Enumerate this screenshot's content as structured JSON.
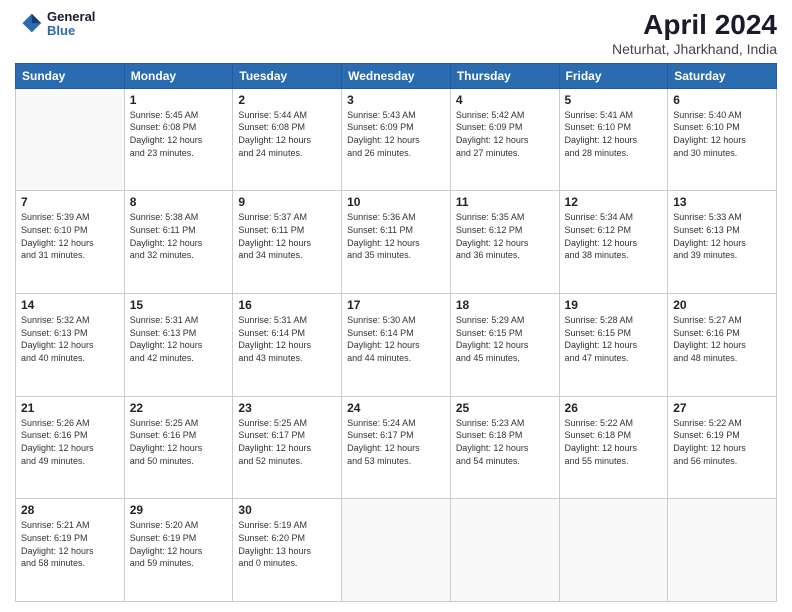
{
  "header": {
    "logo_line1": "General",
    "logo_line2": "Blue",
    "title": "April 2024",
    "subtitle": "Neturhat, Jharkhand, India"
  },
  "calendar": {
    "days_of_week": [
      "Sunday",
      "Monday",
      "Tuesday",
      "Wednesday",
      "Thursday",
      "Friday",
      "Saturday"
    ],
    "weeks": [
      [
        {
          "day": "",
          "info": ""
        },
        {
          "day": "1",
          "info": "Sunrise: 5:45 AM\nSunset: 6:08 PM\nDaylight: 12 hours\nand 23 minutes."
        },
        {
          "day": "2",
          "info": "Sunrise: 5:44 AM\nSunset: 6:08 PM\nDaylight: 12 hours\nand 24 minutes."
        },
        {
          "day": "3",
          "info": "Sunrise: 5:43 AM\nSunset: 6:09 PM\nDaylight: 12 hours\nand 26 minutes."
        },
        {
          "day": "4",
          "info": "Sunrise: 5:42 AM\nSunset: 6:09 PM\nDaylight: 12 hours\nand 27 minutes."
        },
        {
          "day": "5",
          "info": "Sunrise: 5:41 AM\nSunset: 6:10 PM\nDaylight: 12 hours\nand 28 minutes."
        },
        {
          "day": "6",
          "info": "Sunrise: 5:40 AM\nSunset: 6:10 PM\nDaylight: 12 hours\nand 30 minutes."
        }
      ],
      [
        {
          "day": "7",
          "info": "Sunrise: 5:39 AM\nSunset: 6:10 PM\nDaylight: 12 hours\nand 31 minutes."
        },
        {
          "day": "8",
          "info": "Sunrise: 5:38 AM\nSunset: 6:11 PM\nDaylight: 12 hours\nand 32 minutes."
        },
        {
          "day": "9",
          "info": "Sunrise: 5:37 AM\nSunset: 6:11 PM\nDaylight: 12 hours\nand 34 minutes."
        },
        {
          "day": "10",
          "info": "Sunrise: 5:36 AM\nSunset: 6:11 PM\nDaylight: 12 hours\nand 35 minutes."
        },
        {
          "day": "11",
          "info": "Sunrise: 5:35 AM\nSunset: 6:12 PM\nDaylight: 12 hours\nand 36 minutes."
        },
        {
          "day": "12",
          "info": "Sunrise: 5:34 AM\nSunset: 6:12 PM\nDaylight: 12 hours\nand 38 minutes."
        },
        {
          "day": "13",
          "info": "Sunrise: 5:33 AM\nSunset: 6:13 PM\nDaylight: 12 hours\nand 39 minutes."
        }
      ],
      [
        {
          "day": "14",
          "info": "Sunrise: 5:32 AM\nSunset: 6:13 PM\nDaylight: 12 hours\nand 40 minutes."
        },
        {
          "day": "15",
          "info": "Sunrise: 5:31 AM\nSunset: 6:13 PM\nDaylight: 12 hours\nand 42 minutes."
        },
        {
          "day": "16",
          "info": "Sunrise: 5:31 AM\nSunset: 6:14 PM\nDaylight: 12 hours\nand 43 minutes."
        },
        {
          "day": "17",
          "info": "Sunrise: 5:30 AM\nSunset: 6:14 PM\nDaylight: 12 hours\nand 44 minutes."
        },
        {
          "day": "18",
          "info": "Sunrise: 5:29 AM\nSunset: 6:15 PM\nDaylight: 12 hours\nand 45 minutes."
        },
        {
          "day": "19",
          "info": "Sunrise: 5:28 AM\nSunset: 6:15 PM\nDaylight: 12 hours\nand 47 minutes."
        },
        {
          "day": "20",
          "info": "Sunrise: 5:27 AM\nSunset: 6:16 PM\nDaylight: 12 hours\nand 48 minutes."
        }
      ],
      [
        {
          "day": "21",
          "info": "Sunrise: 5:26 AM\nSunset: 6:16 PM\nDaylight: 12 hours\nand 49 minutes."
        },
        {
          "day": "22",
          "info": "Sunrise: 5:25 AM\nSunset: 6:16 PM\nDaylight: 12 hours\nand 50 minutes."
        },
        {
          "day": "23",
          "info": "Sunrise: 5:25 AM\nSunset: 6:17 PM\nDaylight: 12 hours\nand 52 minutes."
        },
        {
          "day": "24",
          "info": "Sunrise: 5:24 AM\nSunset: 6:17 PM\nDaylight: 12 hours\nand 53 minutes."
        },
        {
          "day": "25",
          "info": "Sunrise: 5:23 AM\nSunset: 6:18 PM\nDaylight: 12 hours\nand 54 minutes."
        },
        {
          "day": "26",
          "info": "Sunrise: 5:22 AM\nSunset: 6:18 PM\nDaylight: 12 hours\nand 55 minutes."
        },
        {
          "day": "27",
          "info": "Sunrise: 5:22 AM\nSunset: 6:19 PM\nDaylight: 12 hours\nand 56 minutes."
        }
      ],
      [
        {
          "day": "28",
          "info": "Sunrise: 5:21 AM\nSunset: 6:19 PM\nDaylight: 12 hours\nand 58 minutes."
        },
        {
          "day": "29",
          "info": "Sunrise: 5:20 AM\nSunset: 6:19 PM\nDaylight: 12 hours\nand 59 minutes."
        },
        {
          "day": "30",
          "info": "Sunrise: 5:19 AM\nSunset: 6:20 PM\nDaylight: 13 hours\nand 0 minutes."
        },
        {
          "day": "",
          "info": ""
        },
        {
          "day": "",
          "info": ""
        },
        {
          "day": "",
          "info": ""
        },
        {
          "day": "",
          "info": ""
        }
      ]
    ]
  }
}
